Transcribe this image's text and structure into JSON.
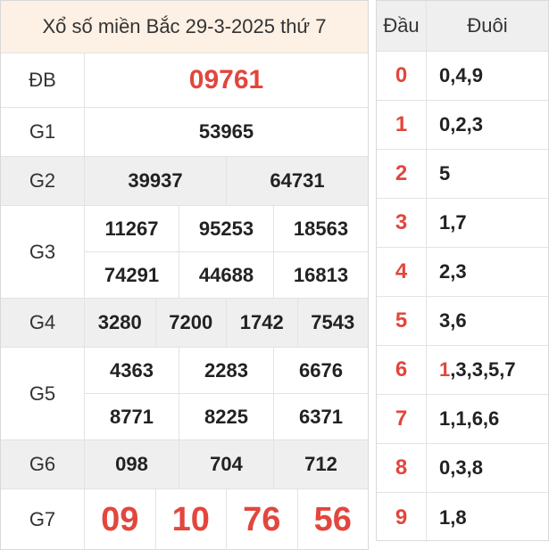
{
  "title": "Xổ số miền Bắc 29-3-2025 thứ 7",
  "prizes": {
    "db": {
      "label": "ĐB",
      "numbers": [
        "09761"
      ]
    },
    "g1": {
      "label": "G1",
      "numbers": [
        "53965"
      ]
    },
    "g2": {
      "label": "G2",
      "numbers": [
        "39937",
        "64731"
      ]
    },
    "g3": {
      "label": "G3",
      "numbers": [
        "11267",
        "95253",
        "18563",
        "74291",
        "44688",
        "16813"
      ]
    },
    "g4": {
      "label": "G4",
      "numbers": [
        "3280",
        "7200",
        "1742",
        "7543"
      ]
    },
    "g5": {
      "label": "G5",
      "numbers": [
        "4363",
        "2283",
        "6676",
        "8771",
        "8225",
        "6371"
      ]
    },
    "g6": {
      "label": "G6",
      "numbers": [
        "098",
        "704",
        "712"
      ]
    },
    "g7": {
      "label": "G7",
      "numbers": [
        "09",
        "10",
        "76",
        "56"
      ]
    }
  },
  "loto": {
    "head_label": "Đầu",
    "tail_label": "Đuôi",
    "rows": [
      {
        "head": "0",
        "tails_hl": "",
        "tails_rest": "0,4,9"
      },
      {
        "head": "1",
        "tails_hl": "",
        "tails_rest": "0,2,3"
      },
      {
        "head": "2",
        "tails_hl": "",
        "tails_rest": "5"
      },
      {
        "head": "3",
        "tails_hl": "",
        "tails_rest": "1,7"
      },
      {
        "head": "4",
        "tails_hl": "",
        "tails_rest": "2,3"
      },
      {
        "head": "5",
        "tails_hl": "",
        "tails_rest": "3,6"
      },
      {
        "head": "6",
        "tails_hl": "1",
        "tails_rest": ",3,3,5,7"
      },
      {
        "head": "7",
        "tails_hl": "",
        "tails_rest": "1,1,6,6"
      },
      {
        "head": "8",
        "tails_hl": "",
        "tails_rest": "0,3,8"
      },
      {
        "head": "9",
        "tails_hl": "",
        "tails_rest": "1,8"
      }
    ]
  },
  "colors": {
    "accent_red": "#e2463d",
    "title_bg": "#fdf0e4",
    "alt_row_bg": "#efefef"
  }
}
